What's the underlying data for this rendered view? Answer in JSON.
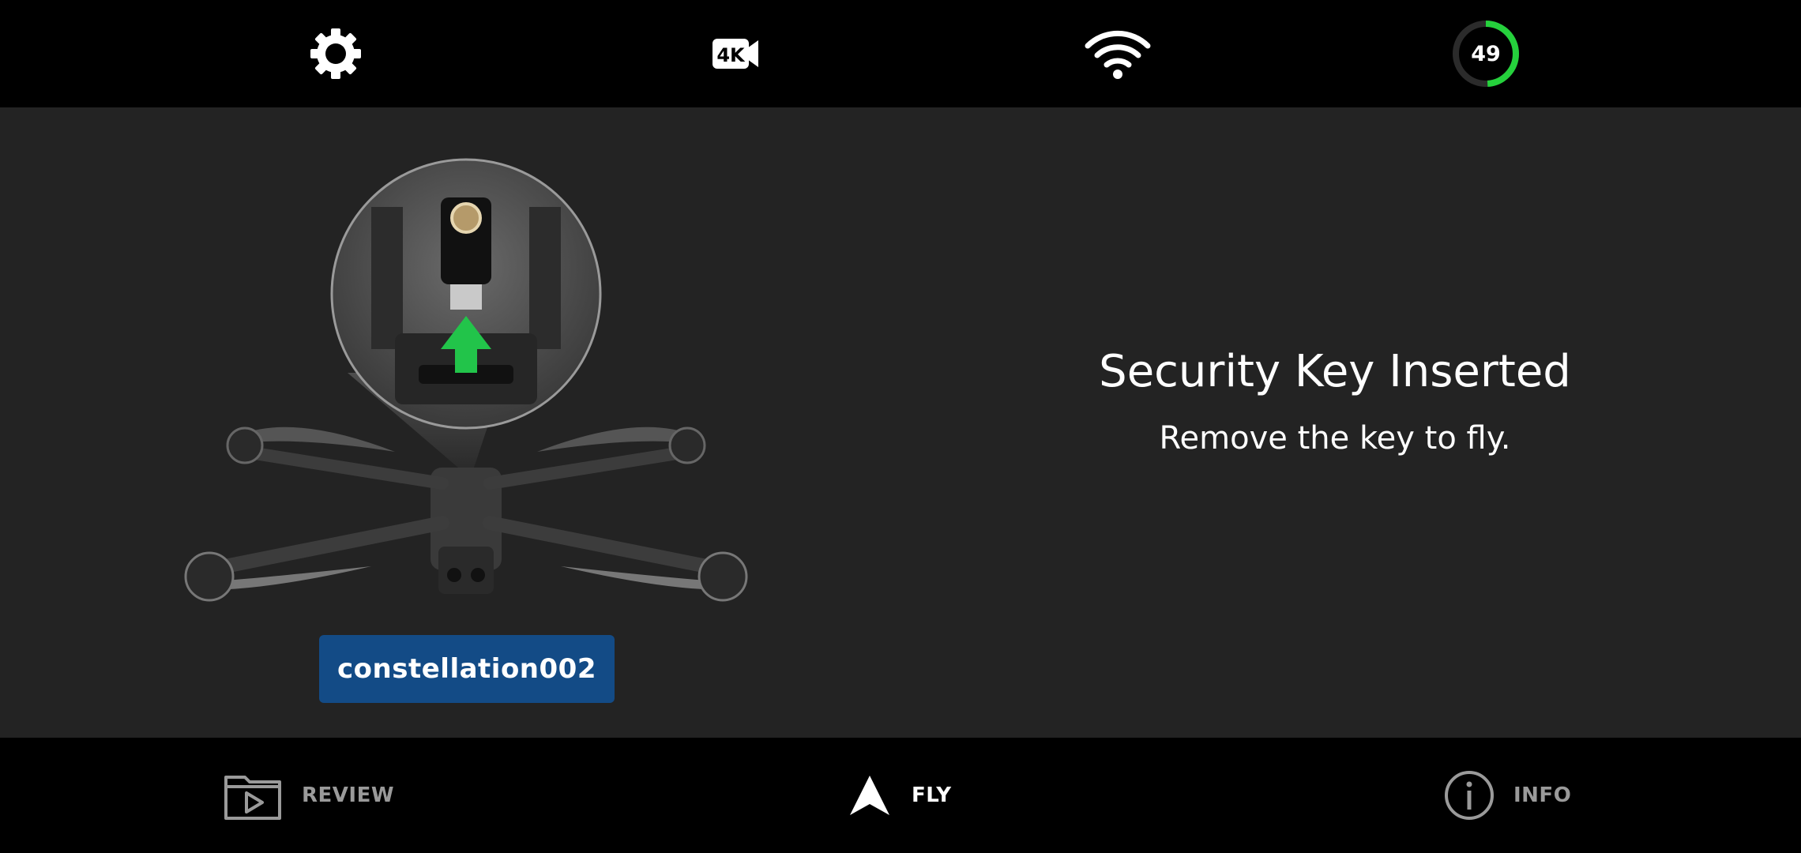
{
  "status_bar": {
    "settings_icon": "gear-icon",
    "camera_icon": "camera-4k-icon",
    "camera_label": "4K",
    "wifi_icon": "wifi-icon",
    "battery_value": "49",
    "battery_percent": 49,
    "battery_color": "#25d13c"
  },
  "message": {
    "title": "Security Key Inserted",
    "subtitle": "Remove the key to fly."
  },
  "device": {
    "name": "constellation002",
    "badge_color": "#134b86"
  },
  "bottom_nav": {
    "review": {
      "label": "REVIEW",
      "icon": "review-folder-play-icon"
    },
    "fly": {
      "label": "FLY",
      "icon": "fly-arrow-icon"
    },
    "info": {
      "label": "INFO",
      "icon": "info-icon"
    }
  }
}
